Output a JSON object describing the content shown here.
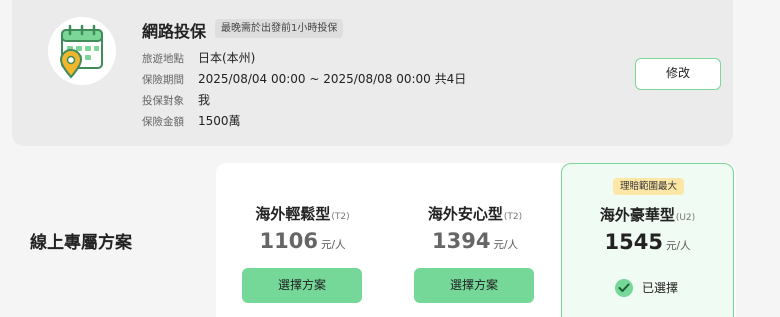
{
  "summary": {
    "title": "網路投保",
    "deadline_tag": "最晚需於出發前1小時投保",
    "icon": "calendar-location-icon",
    "rows": [
      {
        "label": "旅遊地點",
        "value": "日本(本州)"
      },
      {
        "label": "保險期間",
        "value": "2025/08/04 00:00 ~ 2025/08/08 00:00 共4日"
      },
      {
        "label": "投保對象",
        "value": "我"
      },
      {
        "label": "保險金額",
        "value": "1500萬"
      }
    ],
    "edit_label": "修改"
  },
  "section_title": "線上專屬方案",
  "plans": [
    {
      "name": "海外輕鬆型",
      "code": "(T2)",
      "price": "1106",
      "unit": "元/人",
      "button": "選擇方案",
      "selected": false
    },
    {
      "name": "海外安心型",
      "code": "(T2)",
      "price": "1394",
      "unit": "元/人",
      "button": "選擇方案",
      "selected": false
    },
    {
      "name": "海外豪華型",
      "code": "(U2)",
      "price": "1545",
      "unit": "元/人",
      "tag": "理賠範圍最大",
      "selected_label": "已選擇",
      "selected": true
    }
  ],
  "colors": {
    "accent": "#75d898",
    "accent_border": "#7bd697",
    "tag_bg": "#fde7a6"
  }
}
